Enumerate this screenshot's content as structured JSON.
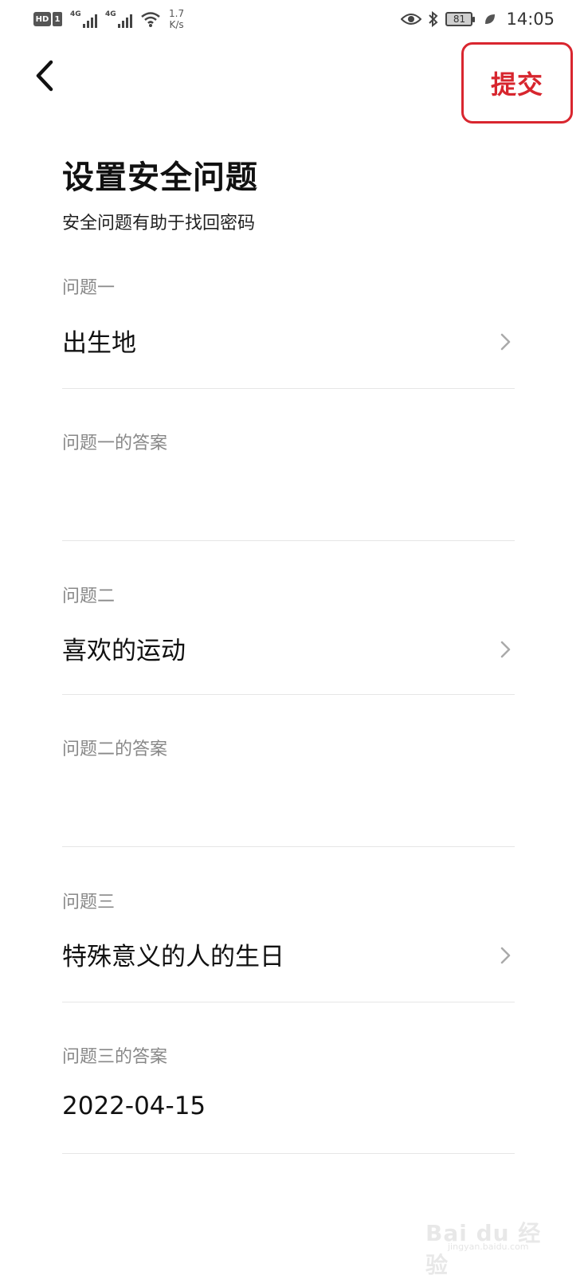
{
  "status_bar": {
    "hd_badge": "HD",
    "sim_badge": "1",
    "signal1_label": "4G",
    "signal2_label": "4G",
    "speed_value": "1.7",
    "speed_unit": "K/s",
    "battery": "81",
    "time": "14:05"
  },
  "nav": {
    "submit_label": "提交"
  },
  "header": {
    "title": "设置安全问题",
    "subtitle": "安全问题有助于找回密码"
  },
  "form": {
    "q1": {
      "label": "问题一",
      "value": "出生地"
    },
    "a1": {
      "label": "问题一的答案",
      "value": ""
    },
    "q2": {
      "label": "问题二",
      "value": "喜欢的运动"
    },
    "a2": {
      "label": "问题二的答案",
      "value": ""
    },
    "q3": {
      "label": "问题三",
      "value": "特殊意义的人的生日"
    },
    "a3": {
      "label": "问题三的答案",
      "value": "2022-04-15"
    }
  },
  "watermark": {
    "text": "Bai du 经验",
    "sub": "jingyan.baidu.com"
  }
}
